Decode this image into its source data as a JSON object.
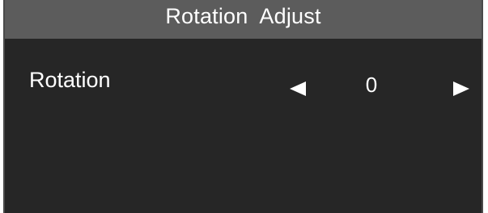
{
  "window": {
    "title": "Rotation  Adjust"
  },
  "setting": {
    "label": "Rotation",
    "value": "0",
    "decrease_icon": "triangle-left-icon",
    "increase_icon": "triangle-right-icon"
  },
  "colors": {
    "panel_background": "#262626",
    "title_bar": "#5c5c5c",
    "text": "#ffffff"
  }
}
